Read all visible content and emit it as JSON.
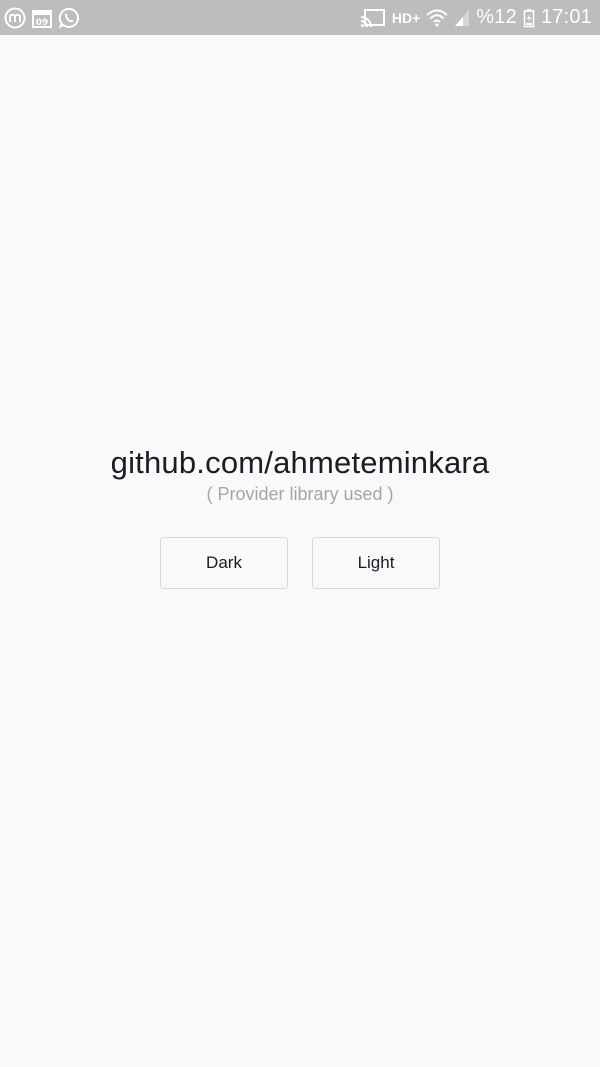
{
  "status_bar": {
    "left_icons": [
      "m-app-icon",
      "calendar-icon",
      "whatsapp-icon"
    ],
    "calendar_day": "09",
    "network_label": "HD+",
    "battery_text": "%12",
    "time": "17:01",
    "right_icons": [
      "cast-icon",
      "wifi-icon",
      "signal-icon",
      "battery-icon"
    ]
  },
  "main": {
    "title": "github.com/ahmeteminkara",
    "subtitle": "( Provider library used )",
    "buttons": {
      "dark_label": "Dark",
      "light_label": "Light"
    }
  },
  "colors": {
    "background": "#f9f8fa",
    "status_bar": "#bdbcbe",
    "title_text": "#1d1c21",
    "subtitle_text": "#a6a5a9",
    "button_border": "#d9d8db"
  }
}
